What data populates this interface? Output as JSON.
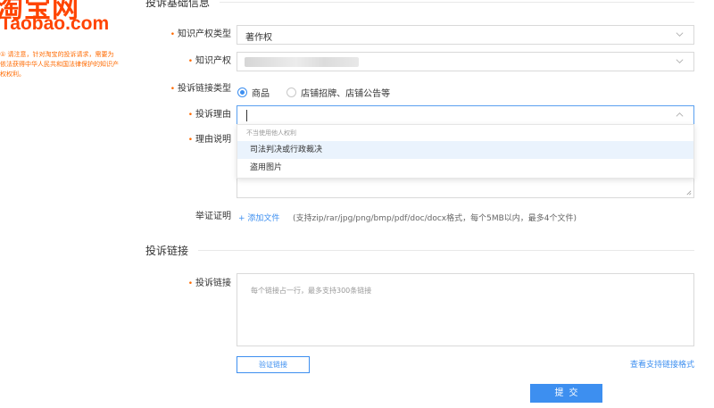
{
  "brand": {
    "logo_cn": "淘宝网",
    "logo_en": "Taobao.com",
    "notice": "① 请注意，针对淘宝的投诉请求，需要为依法获得中华人民共和国法律保护的知识产权权利。"
  },
  "section_basic": {
    "title": "投诉基础信息"
  },
  "section_links": {
    "title": "投诉链接"
  },
  "form": {
    "ip_type": {
      "label": "知识产权类型",
      "value": "著作权"
    },
    "ip": {
      "label": "知识产权"
    },
    "link_type": {
      "label": "投诉链接类型",
      "options": [
        "商品",
        "店铺招牌、店铺公告等"
      ],
      "selected": "商品"
    },
    "reason": {
      "label": "投诉理由",
      "dropdown": {
        "group_label": "不当使用他人权利",
        "items": [
          "司法判决或行政裁决",
          "盗用图片"
        ]
      }
    },
    "explanation": {
      "label": "理由说明"
    },
    "evidence": {
      "label": "举证证明",
      "add_label": "+ 添加文件",
      "hint": "(支持zip/rar/jpg/png/bmp/pdf/doc/docx格式，每个5MB以内，最多4个文件)"
    },
    "links": {
      "label": "投诉链接",
      "placeholder": "每个链接占一行，最多支持300条链接"
    }
  },
  "actions": {
    "verify": "验证链接",
    "format_link": "查看支持链接格式",
    "submit": "提交"
  },
  "colors": {
    "brand": "#ff4400",
    "accent": "#3d8ff0",
    "required": "#ff6a00"
  }
}
